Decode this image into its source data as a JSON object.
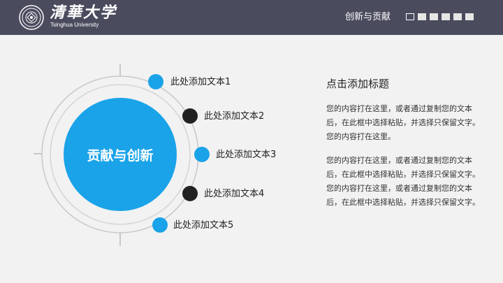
{
  "header": {
    "logo_cn": "清華大学",
    "logo_en": "Tsinghua University",
    "section_title": "创新与贡献",
    "progress": {
      "total": 6,
      "active_index": 0
    }
  },
  "diagram": {
    "center_label": "贡献与创新",
    "items": [
      {
        "label": "此处添加文本1",
        "dot_color": "#1aa3e8"
      },
      {
        "label": "此处添加文本2",
        "dot_color": "#222222"
      },
      {
        "label": "此处添加文本3",
        "dot_color": "#1aa3e8"
      },
      {
        "label": "此处添加文本4",
        "dot_color": "#222222"
      },
      {
        "label": "此处添加文本5",
        "dot_color": "#1aa3e8"
      }
    ]
  },
  "content": {
    "title": "点击添加标题",
    "paragraph_1": "您的内容打在这里，或者通过复制您的文本后，在此框中选择粘贴，并选择只保留文字。您的内容打在这里。",
    "paragraph_2": "您的内容打在这里，或者通过复制您的文本后，在此框中选择粘贴，并选择只保留文字。您的内容打在这里，或者通过复制您的文本后，在此框中选择粘贴，并选择只保留文字。"
  },
  "colors": {
    "header_bg": "#4a4c5e",
    "accent_blue": "#1aa3e8",
    "dark_dot": "#222222",
    "background": "#f2f2f2"
  }
}
